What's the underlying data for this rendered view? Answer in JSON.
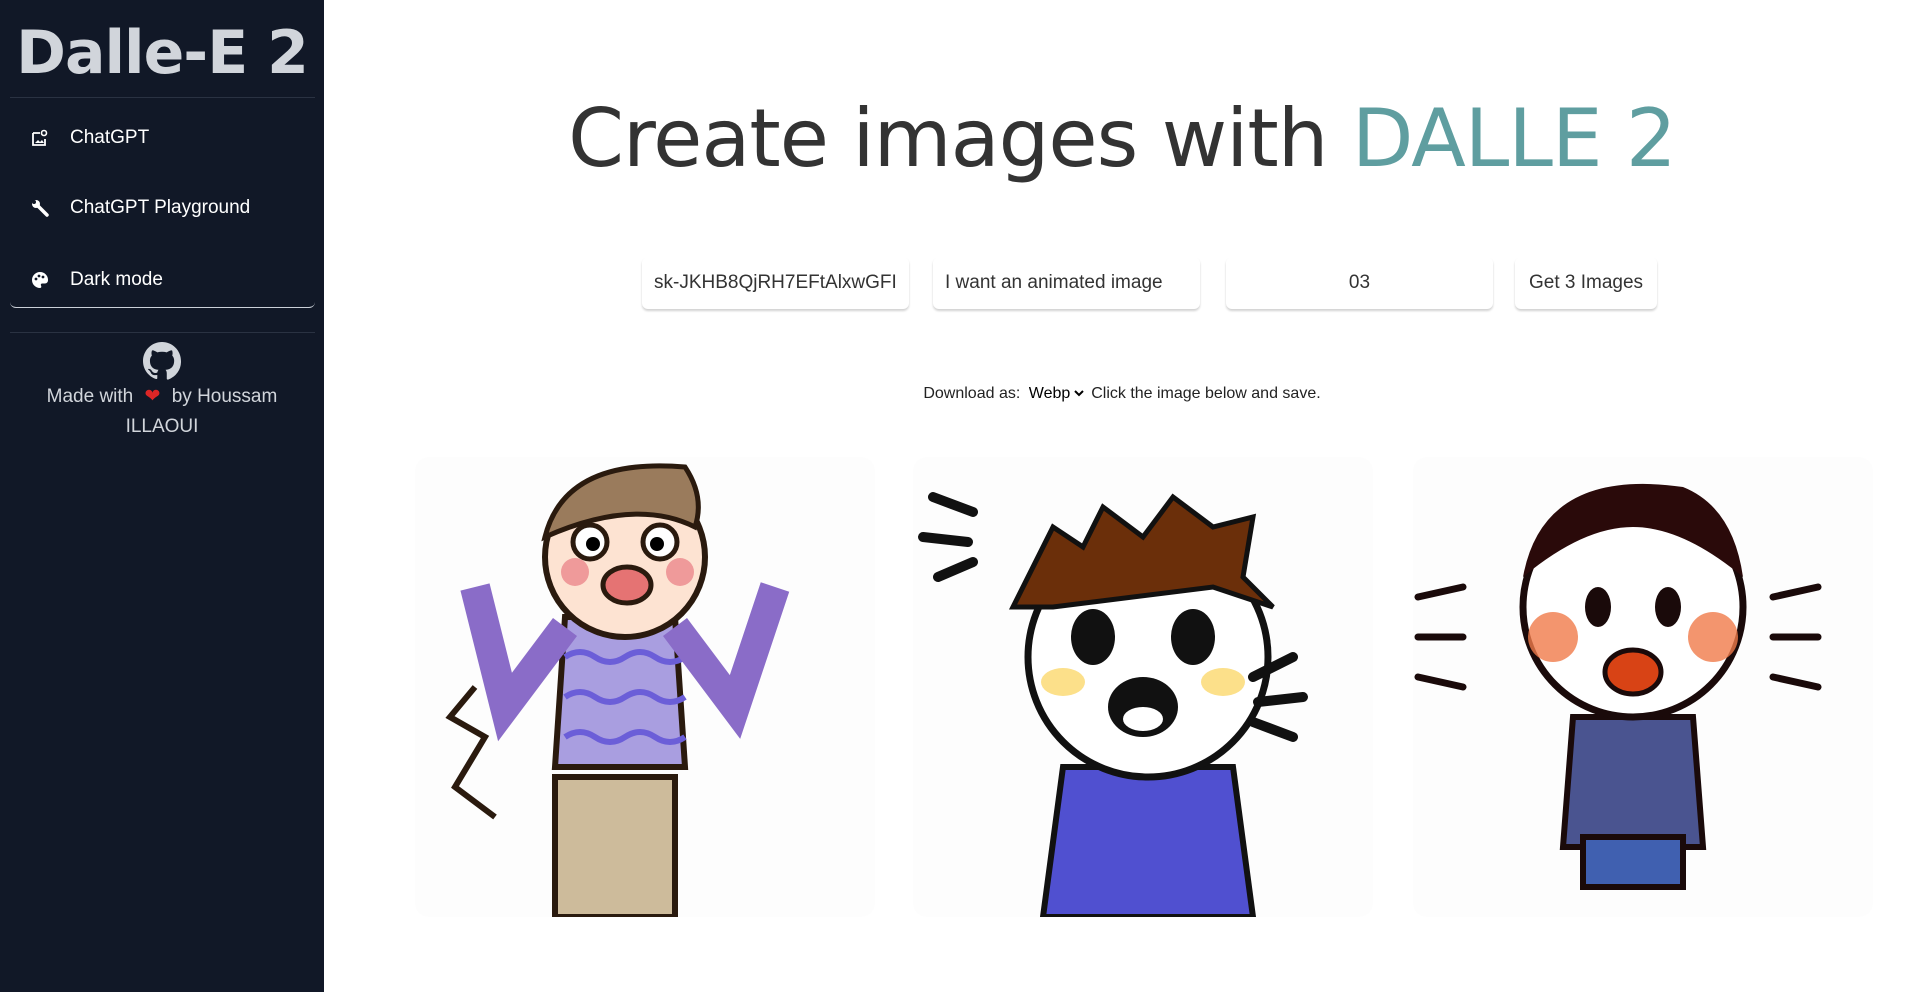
{
  "sidebar": {
    "brand": "Dalle-E 2",
    "items": [
      {
        "label": "ChatGPT",
        "icon": "image-search-icon"
      },
      {
        "label": "ChatGPT Playground",
        "icon": "wrench-icon"
      },
      {
        "label": "Dark mode",
        "icon": "palette-icon"
      }
    ],
    "footer": {
      "made_with": "Made with",
      "by": "by Houssam ILLAOUI",
      "icons": [
        "github-icon",
        "heart-icon"
      ]
    }
  },
  "main": {
    "title": "Create images with",
    "title_accent": "DALLE 2",
    "accent_color": "#5f9ea0",
    "api_key_value": "sk-JKHB8QjRH7EFtAlxwGFI",
    "prompt_value": "I want an animated image",
    "count_value": "03",
    "submit_label": "Get 3 Images",
    "download_label": "Download as:",
    "download_format": "Webp",
    "download_hint": "Click the image below and save.",
    "images": [
      "frightened cartoon boy in purple sweater",
      "shocked cartoon boy in blue shirt",
      "scared cartoon boy in blue tank top"
    ]
  }
}
